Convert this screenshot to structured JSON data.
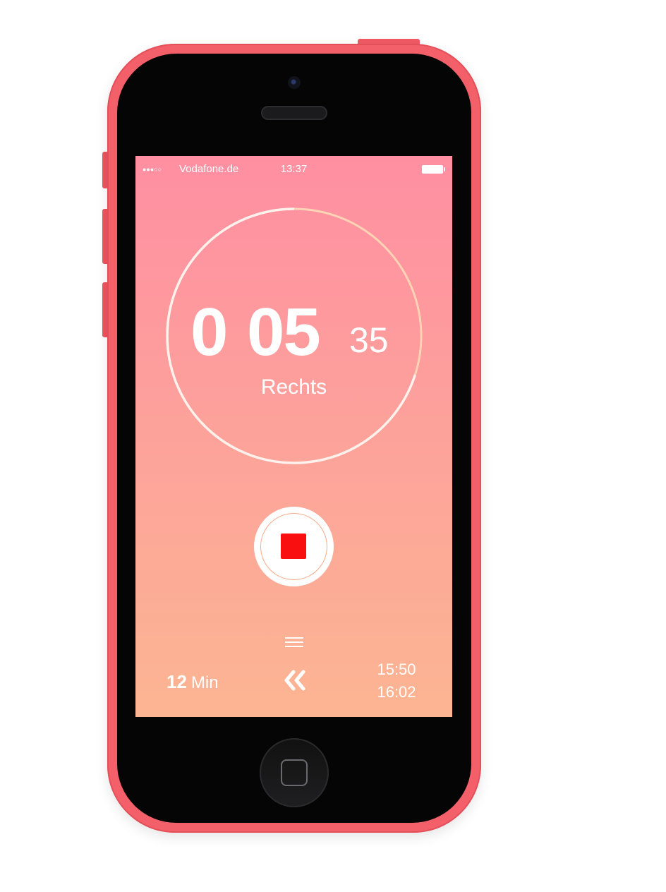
{
  "status_bar": {
    "signal": "●●●○○",
    "carrier": "Vodafone.de",
    "time": "13:37"
  },
  "timer": {
    "hours": "0",
    "minutes": "05",
    "seconds": "35",
    "side": "Rechts",
    "progress_fraction": 0.7
  },
  "controls": {
    "stop_icon": "stop-square-icon",
    "menu_icon": "hamburger-menu-icon",
    "back_icon": "double-chevron-left-icon"
  },
  "footer": {
    "duration_value": "12",
    "duration_unit": "Min",
    "time_start": "15:50",
    "time_end": "16:02"
  },
  "colors": {
    "screen_gradient_top": "#fe8fa2",
    "screen_gradient_bottom": "#fcb592",
    "ring_done": "#fff2ec",
    "ring_remaining": "#fcd3b5",
    "stop_red": "#fa0f10",
    "phone_body": "#f4606a"
  }
}
